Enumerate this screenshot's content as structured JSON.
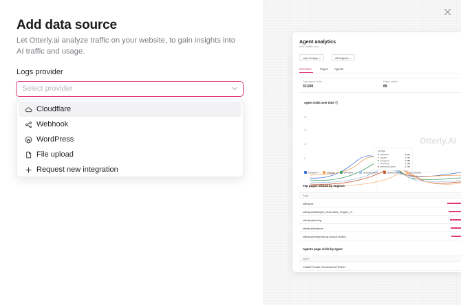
{
  "dialog": {
    "title": "Add data source",
    "subtitle": "Let Otterly.ai analyze traffic on your website, to gain insights into AI traffic and usage.",
    "field_label": "Logs provider",
    "select_placeholder": "Select provider"
  },
  "menu": {
    "items": [
      {
        "label": "Cloudflare",
        "icon": "cloud-icon"
      },
      {
        "label": "Webhook",
        "icon": "share-nodes-icon"
      },
      {
        "label": "WordPress",
        "icon": "wordpress-icon"
      },
      {
        "label": "File upload",
        "icon": "file-icon"
      },
      {
        "label": "Request new integration",
        "icon": "plus-icon"
      }
    ]
  },
  "preview": {
    "title": "Agent analytics",
    "subtitle": "Add subtitle here",
    "filter_range": "Last 14 days",
    "filter_engines": "All Engines",
    "tabs": [
      "Overview",
      "Pages",
      "Agents"
    ],
    "stats": [
      {
        "label": "Total agents visits",
        "value": "32,500"
      },
      {
        "label": "Pages visited",
        "value": "89"
      }
    ],
    "chart_title": "Agent visits over time",
    "chart_data": {
      "type": "line",
      "x": [
        "10 Sept",
        "11 Sept",
        "12 Sept",
        "13 Sept",
        "14 Sept",
        "15 Sept"
      ],
      "tooltip": {
        "date": "14 Sept",
        "rows": [
          {
            "name": "ChatGPT",
            "value": "3,560"
          },
          {
            "name": "Claude",
            "value": "1,789"
          },
          {
            "name": "Google AI",
            "value": "1,789"
          },
          {
            "name": "Perplexity",
            "value": "1,789"
          },
          {
            "name": "Microsoft Copilot",
            "value": "1,789"
          }
        ]
      }
    },
    "legend": [
      {
        "name": "ChatGPT",
        "color": "#3b6fd8"
      },
      {
        "name": "Claude",
        "color": "#f0a050"
      },
      {
        "name": "GPTBot",
        "color": "#3fa066"
      },
      {
        "name": "GoogleOther",
        "color": "#9ec3f0"
      },
      {
        "name": "NotebookLM",
        "color": "#c7572b"
      },
      {
        "name": "Perplexity",
        "color": "#f4b98a"
      }
    ],
    "watermark": "Otterly.AI",
    "top_pages_title": "Top pages visited by engines",
    "top_pages_header": "Page",
    "top_pages": [
      {
        "page": "otterly.ai/"
      },
      {
        "page": "otterly.ai/OtterlyAI_Generative_Engine_O..."
      },
      {
        "page": "otterly.ai/pricing"
      },
      {
        "page": "otterly.ai/features"
      },
      {
        "page": "otterly.ai/enterprise-ai-search-visibili..."
      }
    ],
    "agents_title": "Agents page visits by types",
    "agents_header": "Agent",
    "agents_rows": [
      {
        "agent": "ChatGPT-User On-Demand Fetcher"
      }
    ]
  },
  "colors": {
    "accent": "#e0397c"
  }
}
